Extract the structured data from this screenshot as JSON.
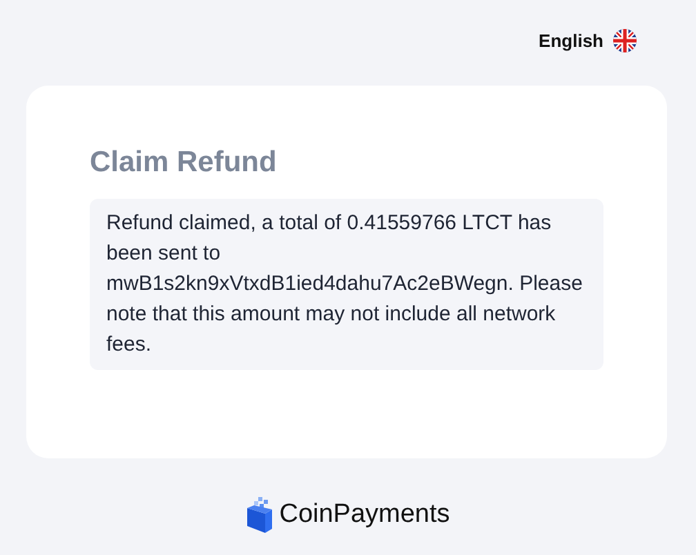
{
  "language": {
    "label": "English"
  },
  "card": {
    "title": "Claim Refund",
    "message": "Refund claimed, a total of 0.41559766 LTCT has been sent to mwB1s2kn9xVtxdB1ied4dahu7Ac2eBWegn. Please note that this amount may not include all network fees."
  },
  "footer": {
    "brand": "CoinPayments"
  }
}
